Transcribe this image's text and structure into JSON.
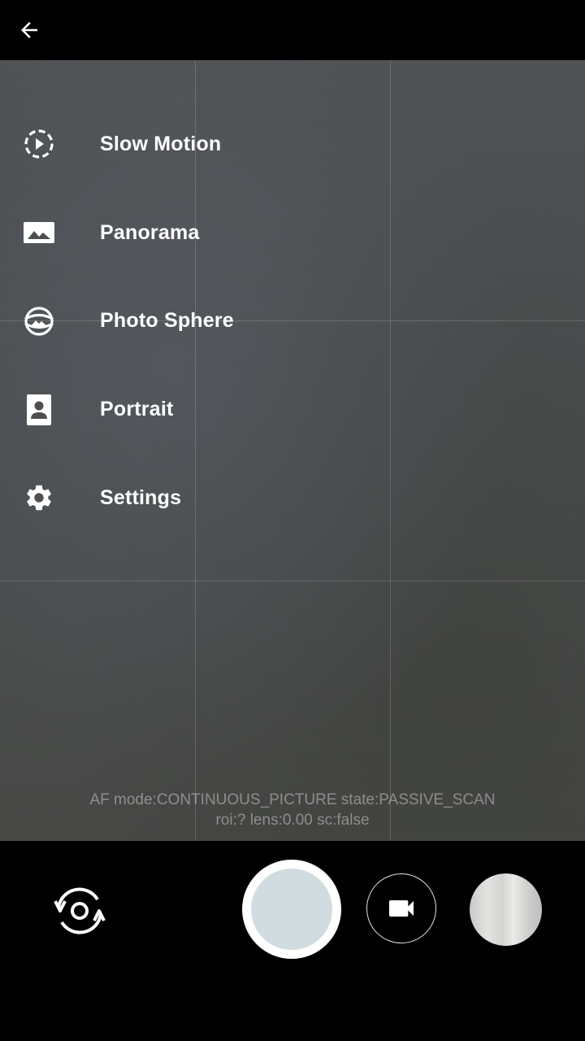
{
  "top_bar": {
    "back_icon": "arrow-back-icon"
  },
  "menu": {
    "items": [
      {
        "label": "Slow Motion",
        "icon": "slow-motion-icon"
      },
      {
        "label": "Panorama",
        "icon": "panorama-icon"
      },
      {
        "label": "Photo Sphere",
        "icon": "photo-sphere-icon"
      },
      {
        "label": "Portrait",
        "icon": "portrait-icon"
      },
      {
        "label": "Settings",
        "icon": "gear-icon"
      }
    ]
  },
  "debug": {
    "line1": "AF mode:CONTINUOUS_PICTURE state:PASSIVE_SCAN",
    "line2": "roi:? lens:0.00 sc:false"
  },
  "bottom_bar": {
    "switch_icon": "switch-camera-icon",
    "video_icon": "videocam-icon"
  },
  "colors": {
    "background": "#000000",
    "shutter_inner": "#d0dce0",
    "text": "#ffffff"
  }
}
